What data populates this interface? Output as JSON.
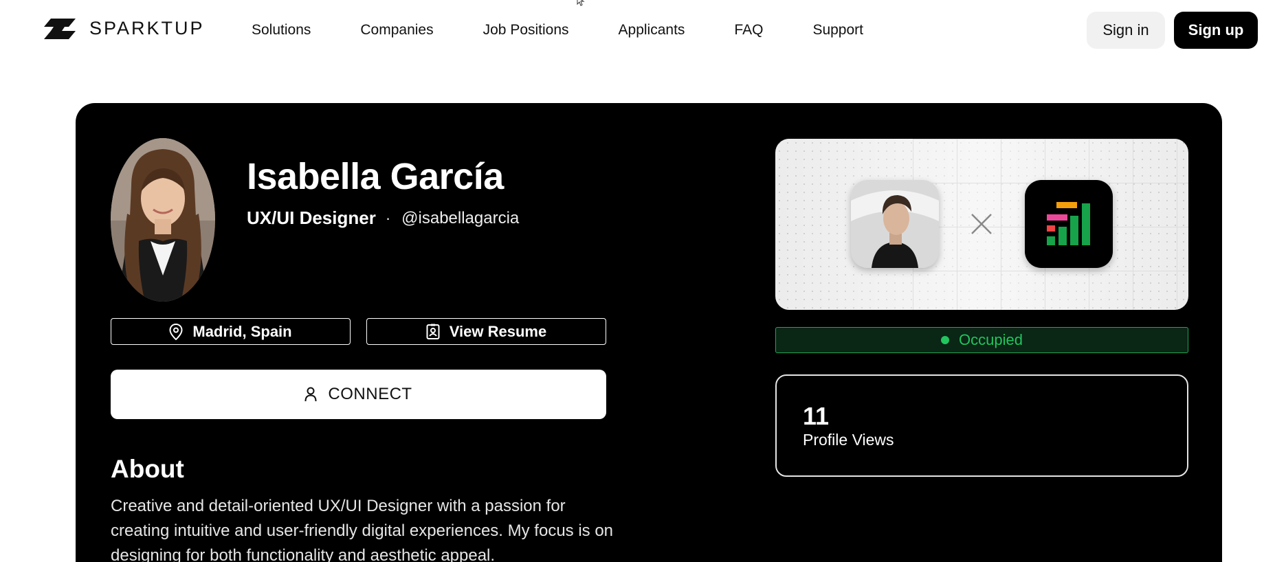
{
  "nav": {
    "brand": "SPARKTUP",
    "links": [
      "Solutions",
      "Companies",
      "Job Positions",
      "Applicants",
      "FAQ",
      "Support"
    ],
    "signin_label": "Sign in",
    "signup_label": "Sign up"
  },
  "profile": {
    "name": "Isabella García",
    "role": "UX/UI Designer",
    "separator": "·",
    "handle": "@isabellagarcia",
    "location": "Madrid, Spain",
    "resume_label": "View Resume",
    "connect_label": "CONNECT"
  },
  "about": {
    "title": "About",
    "text": "Creative and detail-oriented UX/UI Designer with a passion for creating intuitive and user-friendly digital experiences. My focus is on designing for both functionality and aesthetic appeal."
  },
  "status": {
    "label": "Occupied",
    "color": "#22c55e"
  },
  "stats": {
    "profile_views": "11",
    "profile_views_label": "Profile Views"
  },
  "colors": {
    "card_bg": "#000000",
    "accent_green": "#22c55e",
    "app_orange": "#f59e0b",
    "app_pink": "#ec4899",
    "app_red": "#ef4444",
    "app_green": "#16a34a"
  }
}
